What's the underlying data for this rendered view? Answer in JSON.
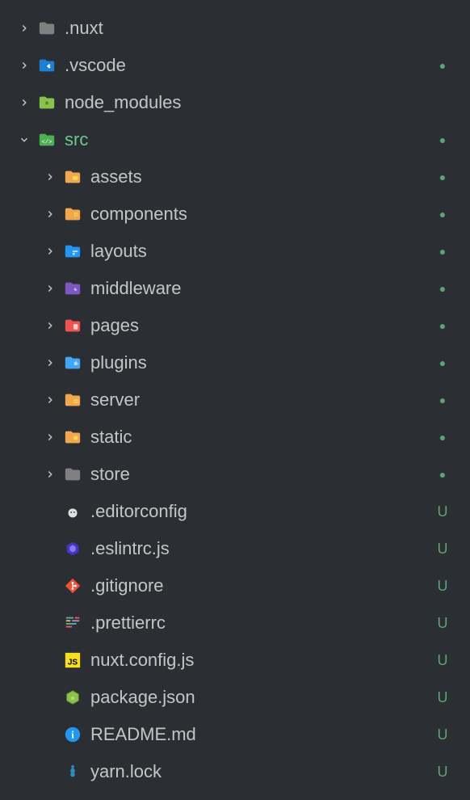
{
  "tree": [
    {
      "id": "nuxt",
      "label": ".nuxt",
      "depth": 0,
      "expandable": true,
      "expanded": false,
      "iconType": "folder-gray",
      "status": ""
    },
    {
      "id": "vscode",
      "label": ".vscode",
      "depth": 0,
      "expandable": true,
      "expanded": false,
      "iconType": "folder-vscode",
      "status": "dot"
    },
    {
      "id": "node_modules",
      "label": "node_modules",
      "depth": 0,
      "expandable": true,
      "expanded": false,
      "iconType": "folder-node",
      "status": ""
    },
    {
      "id": "src",
      "label": "src",
      "depth": 0,
      "expandable": true,
      "expanded": true,
      "iconType": "folder-src",
      "status": "dot",
      "labelClass": "src-label"
    },
    {
      "id": "assets",
      "label": "assets",
      "depth": 1,
      "expandable": true,
      "expanded": false,
      "iconType": "folder-assets",
      "status": "dot"
    },
    {
      "id": "components",
      "label": "components",
      "depth": 1,
      "expandable": true,
      "expanded": false,
      "iconType": "folder-components",
      "status": "dot"
    },
    {
      "id": "layouts",
      "label": "layouts",
      "depth": 1,
      "expandable": true,
      "expanded": false,
      "iconType": "folder-layouts",
      "status": "dot"
    },
    {
      "id": "middleware",
      "label": "middleware",
      "depth": 1,
      "expandable": true,
      "expanded": false,
      "iconType": "folder-middleware",
      "status": "dot"
    },
    {
      "id": "pages",
      "label": "pages",
      "depth": 1,
      "expandable": true,
      "expanded": false,
      "iconType": "folder-pages",
      "status": "dot"
    },
    {
      "id": "plugins",
      "label": "plugins",
      "depth": 1,
      "expandable": true,
      "expanded": false,
      "iconType": "folder-plugins",
      "status": "dot"
    },
    {
      "id": "server",
      "label": "server",
      "depth": 1,
      "expandable": true,
      "expanded": false,
      "iconType": "folder-server",
      "status": "dot"
    },
    {
      "id": "static",
      "label": "static",
      "depth": 1,
      "expandable": true,
      "expanded": false,
      "iconType": "folder-static",
      "status": "dot"
    },
    {
      "id": "store",
      "label": "store",
      "depth": 1,
      "expandable": true,
      "expanded": false,
      "iconType": "folder-gray",
      "status": "dot"
    },
    {
      "id": "editorconfig",
      "label": ".editorconfig",
      "depth": 1,
      "expandable": false,
      "iconType": "editorconfig",
      "status": "U"
    },
    {
      "id": "eslintrc",
      "label": ".eslintrc.js",
      "depth": 1,
      "expandable": false,
      "iconType": "eslint",
      "status": "U"
    },
    {
      "id": "gitignore",
      "label": ".gitignore",
      "depth": 1,
      "expandable": false,
      "iconType": "git",
      "status": "U"
    },
    {
      "id": "prettierrc",
      "label": ".prettierrc",
      "depth": 1,
      "expandable": false,
      "iconType": "prettier",
      "status": "U"
    },
    {
      "id": "nuxtconfig",
      "label": "nuxt.config.js",
      "depth": 1,
      "expandable": false,
      "iconType": "js",
      "status": "U"
    },
    {
      "id": "packagejson",
      "label": "package.json",
      "depth": 1,
      "expandable": false,
      "iconType": "npm",
      "status": "U"
    },
    {
      "id": "readme",
      "label": "README.md",
      "depth": 1,
      "expandable": false,
      "iconType": "info",
      "status": "U"
    },
    {
      "id": "yarnlock",
      "label": "yarn.lock",
      "depth": 1,
      "expandable": false,
      "iconType": "yarn",
      "status": "U"
    }
  ]
}
